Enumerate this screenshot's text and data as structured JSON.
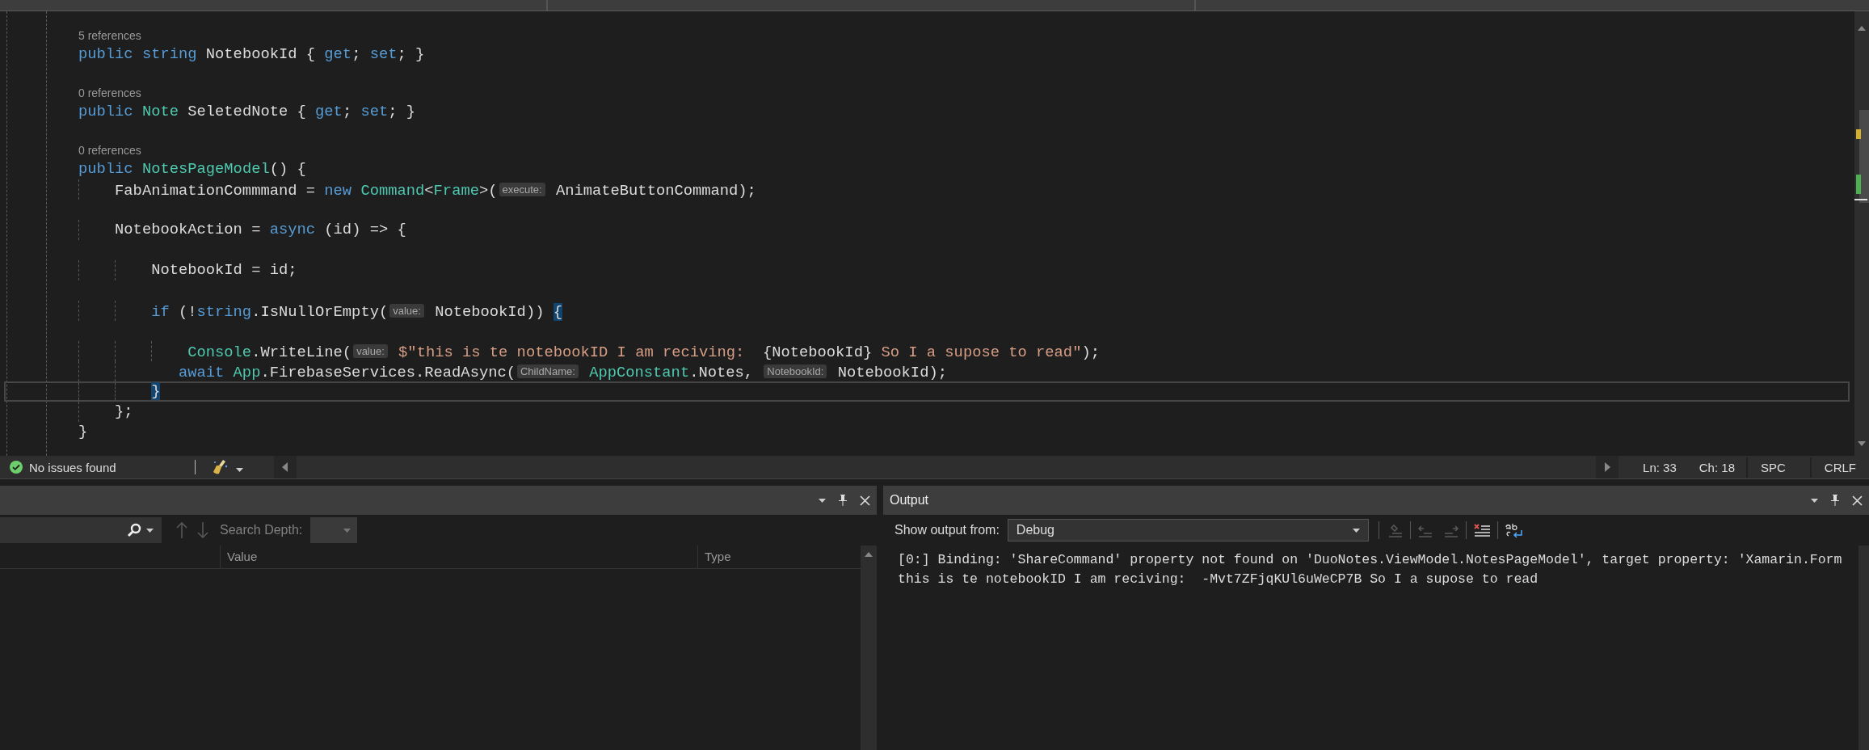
{
  "editor": {
    "lines": [
      {
        "kind": "codelens",
        "text": "5 references"
      },
      {
        "kind": "code",
        "current": false,
        "tokens": [
          {
            "kind": "keyword",
            "text": "public string"
          },
          {
            "kind": "plain",
            "text": " NotebookId { "
          },
          {
            "kind": "keyword",
            "text": "get"
          },
          {
            "kind": "plain",
            "text": "; "
          },
          {
            "kind": "keyword",
            "text": "set"
          },
          {
            "kind": "plain",
            "text": "; }"
          }
        ]
      },
      {
        "kind": "blank"
      },
      {
        "kind": "codelens",
        "text": "0 references"
      },
      {
        "kind": "code",
        "current": false,
        "tokens": [
          {
            "kind": "keyword",
            "text": "public "
          },
          {
            "kind": "type",
            "text": "Note"
          },
          {
            "kind": "plain",
            "text": " SeletedNote { "
          },
          {
            "kind": "keyword",
            "text": "get"
          },
          {
            "kind": "plain",
            "text": "; "
          },
          {
            "kind": "keyword",
            "text": "set"
          },
          {
            "kind": "plain",
            "text": "; }"
          }
        ]
      },
      {
        "kind": "blank"
      },
      {
        "kind": "codelens",
        "text": "0 references"
      },
      {
        "kind": "code",
        "current": false,
        "tokens": [
          {
            "kind": "keyword",
            "text": "public "
          },
          {
            "kind": "type",
            "text": "NotesPageModel"
          },
          {
            "kind": "plain",
            "text": "() {"
          }
        ]
      },
      {
        "kind": "code",
        "current": false,
        "tokens": [
          {
            "kind": "plain",
            "text": "    FabAnimationCommmand = "
          },
          {
            "kind": "keyword",
            "text": "new "
          },
          {
            "kind": "type",
            "text": "Command"
          },
          {
            "kind": "plain",
            "text": "<"
          },
          {
            "kind": "type",
            "text": "Frame"
          },
          {
            "kind": "plain",
            "text": ">("
          },
          {
            "kind": "hint",
            "text": "execute:"
          },
          {
            "kind": "plain",
            "text": " AnimateButtonCommand);"
          }
        ]
      },
      {
        "kind": "blank"
      },
      {
        "kind": "code",
        "current": false,
        "tokens": [
          {
            "kind": "plain",
            "text": "    NotebookAction = "
          },
          {
            "kind": "keyword",
            "text": "async"
          },
          {
            "kind": "plain",
            "text": " (id) => {"
          }
        ]
      },
      {
        "kind": "blank"
      },
      {
        "kind": "code",
        "current": false,
        "tokens": [
          {
            "kind": "plain",
            "text": "        NotebookId = id;"
          }
        ]
      },
      {
        "kind": "blank"
      },
      {
        "kind": "code",
        "current": false,
        "tokens": [
          {
            "kind": "keyword",
            "text": "        if"
          },
          {
            "kind": "plain",
            "text": " (!"
          },
          {
            "kind": "keyword",
            "text": "string"
          },
          {
            "kind": "plain",
            "text": ".IsNullOrEmpty("
          },
          {
            "kind": "hint",
            "text": "value:"
          },
          {
            "kind": "plain",
            "text": " NotebookId)) "
          },
          {
            "kind": "brace",
            "text": "{"
          }
        ]
      },
      {
        "kind": "blank"
      },
      {
        "kind": "code",
        "current": false,
        "tokens": [
          {
            "kind": "type",
            "text": "            Console"
          },
          {
            "kind": "plain",
            "text": ".WriteLine("
          },
          {
            "kind": "hint",
            "text": "value:"
          },
          {
            "kind": "string",
            "text": " $\"this is te notebookID I am reciving:  "
          },
          {
            "kind": "plain",
            "text": "{NotebookId}"
          },
          {
            "kind": "string",
            "text": " So I a supose to read\""
          },
          {
            "kind": "plain",
            "text": ");"
          }
        ]
      },
      {
        "kind": "code",
        "current": false,
        "tokens": [
          {
            "kind": "keyword",
            "text": "           await "
          },
          {
            "kind": "type",
            "text": "App"
          },
          {
            "kind": "plain",
            "text": ".FirebaseServices.ReadAsync("
          },
          {
            "kind": "hint",
            "text": "ChildName:"
          },
          {
            "kind": "type",
            "text": " AppConstant"
          },
          {
            "kind": "plain",
            "text": ".Notes, "
          },
          {
            "kind": "hint",
            "text": "NotebookId:"
          },
          {
            "kind": "plain",
            "text": " NotebookId);"
          }
        ]
      },
      {
        "kind": "code",
        "current": true,
        "tokens": [
          {
            "kind": "brace",
            "text": "        }"
          }
        ]
      },
      {
        "kind": "code",
        "current": false,
        "tokens": [
          {
            "kind": "plain",
            "text": "    };"
          }
        ]
      },
      {
        "kind": "code",
        "current": false,
        "tokens": [
          {
            "kind": "plain",
            "text": "}"
          }
        ]
      }
    ]
  },
  "status_bar": {
    "issues": "No issues found",
    "line": "Ln: 33",
    "column": "Ch: 18",
    "indentation": "SPC",
    "line_endings": "CRLF"
  },
  "watch_panel": {
    "search_depth_label": "Search Depth:",
    "columns": [
      "Value",
      "Type"
    ]
  },
  "output_panel": {
    "title": "Output",
    "source_label": "Show output from:",
    "source": "Debug",
    "lines": [
      "[0:] Binding: 'ShareCommand' property not found on 'DuoNotes.ViewModel.NotesPageModel', target property: 'Xamarin.Form",
      "this is te notebookID I am reciving:  -Mvt7ZFjqKUl6uWeCP7B So I a supose to read"
    ]
  }
}
